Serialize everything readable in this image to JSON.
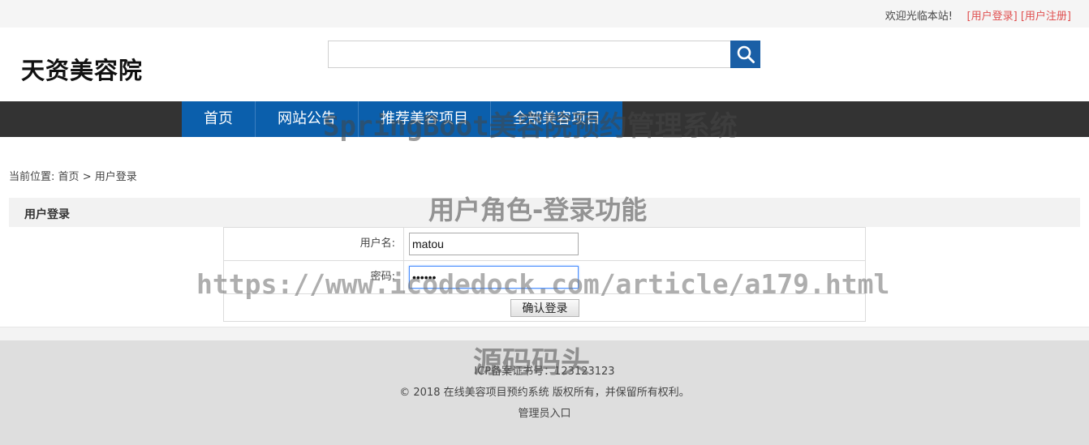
{
  "topbar": {
    "welcome": "欢迎光临本站!",
    "login_link": "[用户登录]",
    "register_link": "[用户注册]",
    "link_color": "#e05050"
  },
  "header": {
    "logo": "天资美容院",
    "search": {
      "placeholder": "",
      "value": "",
      "button_icon": "search-icon",
      "button_color": "#1a5fa6"
    }
  },
  "nav": {
    "items": [
      {
        "label": "首页"
      },
      {
        "label": "网站公告"
      },
      {
        "label": "推荐美容项目"
      },
      {
        "label": "全部美容项目"
      }
    ],
    "bar_color": "#333333",
    "item_color": "#0b5fac"
  },
  "breadcrumb": {
    "prefix": "当前位置:",
    "home": "首页",
    "separator": ">",
    "current": "用户登录"
  },
  "panel": {
    "title": "用户登录"
  },
  "form": {
    "username_label": "用户名:",
    "username_value": "matou",
    "password_label": "密码:",
    "password_value": "••••••",
    "submit_label": "确认登录"
  },
  "footer": {
    "icp": "ICP备案证书号：123123123",
    "copyright": "© 2018 在线美容项目预约系统 版权所有，并保留所有权利。",
    "admin_link": "管理员入口"
  },
  "watermarks": {
    "title": "SpringBoot美容院预约管理系统",
    "subtitle": "用户角色-登录功能",
    "url": "https://www.icodedock.com/article/a179.html",
    "brand": "源码码头"
  }
}
